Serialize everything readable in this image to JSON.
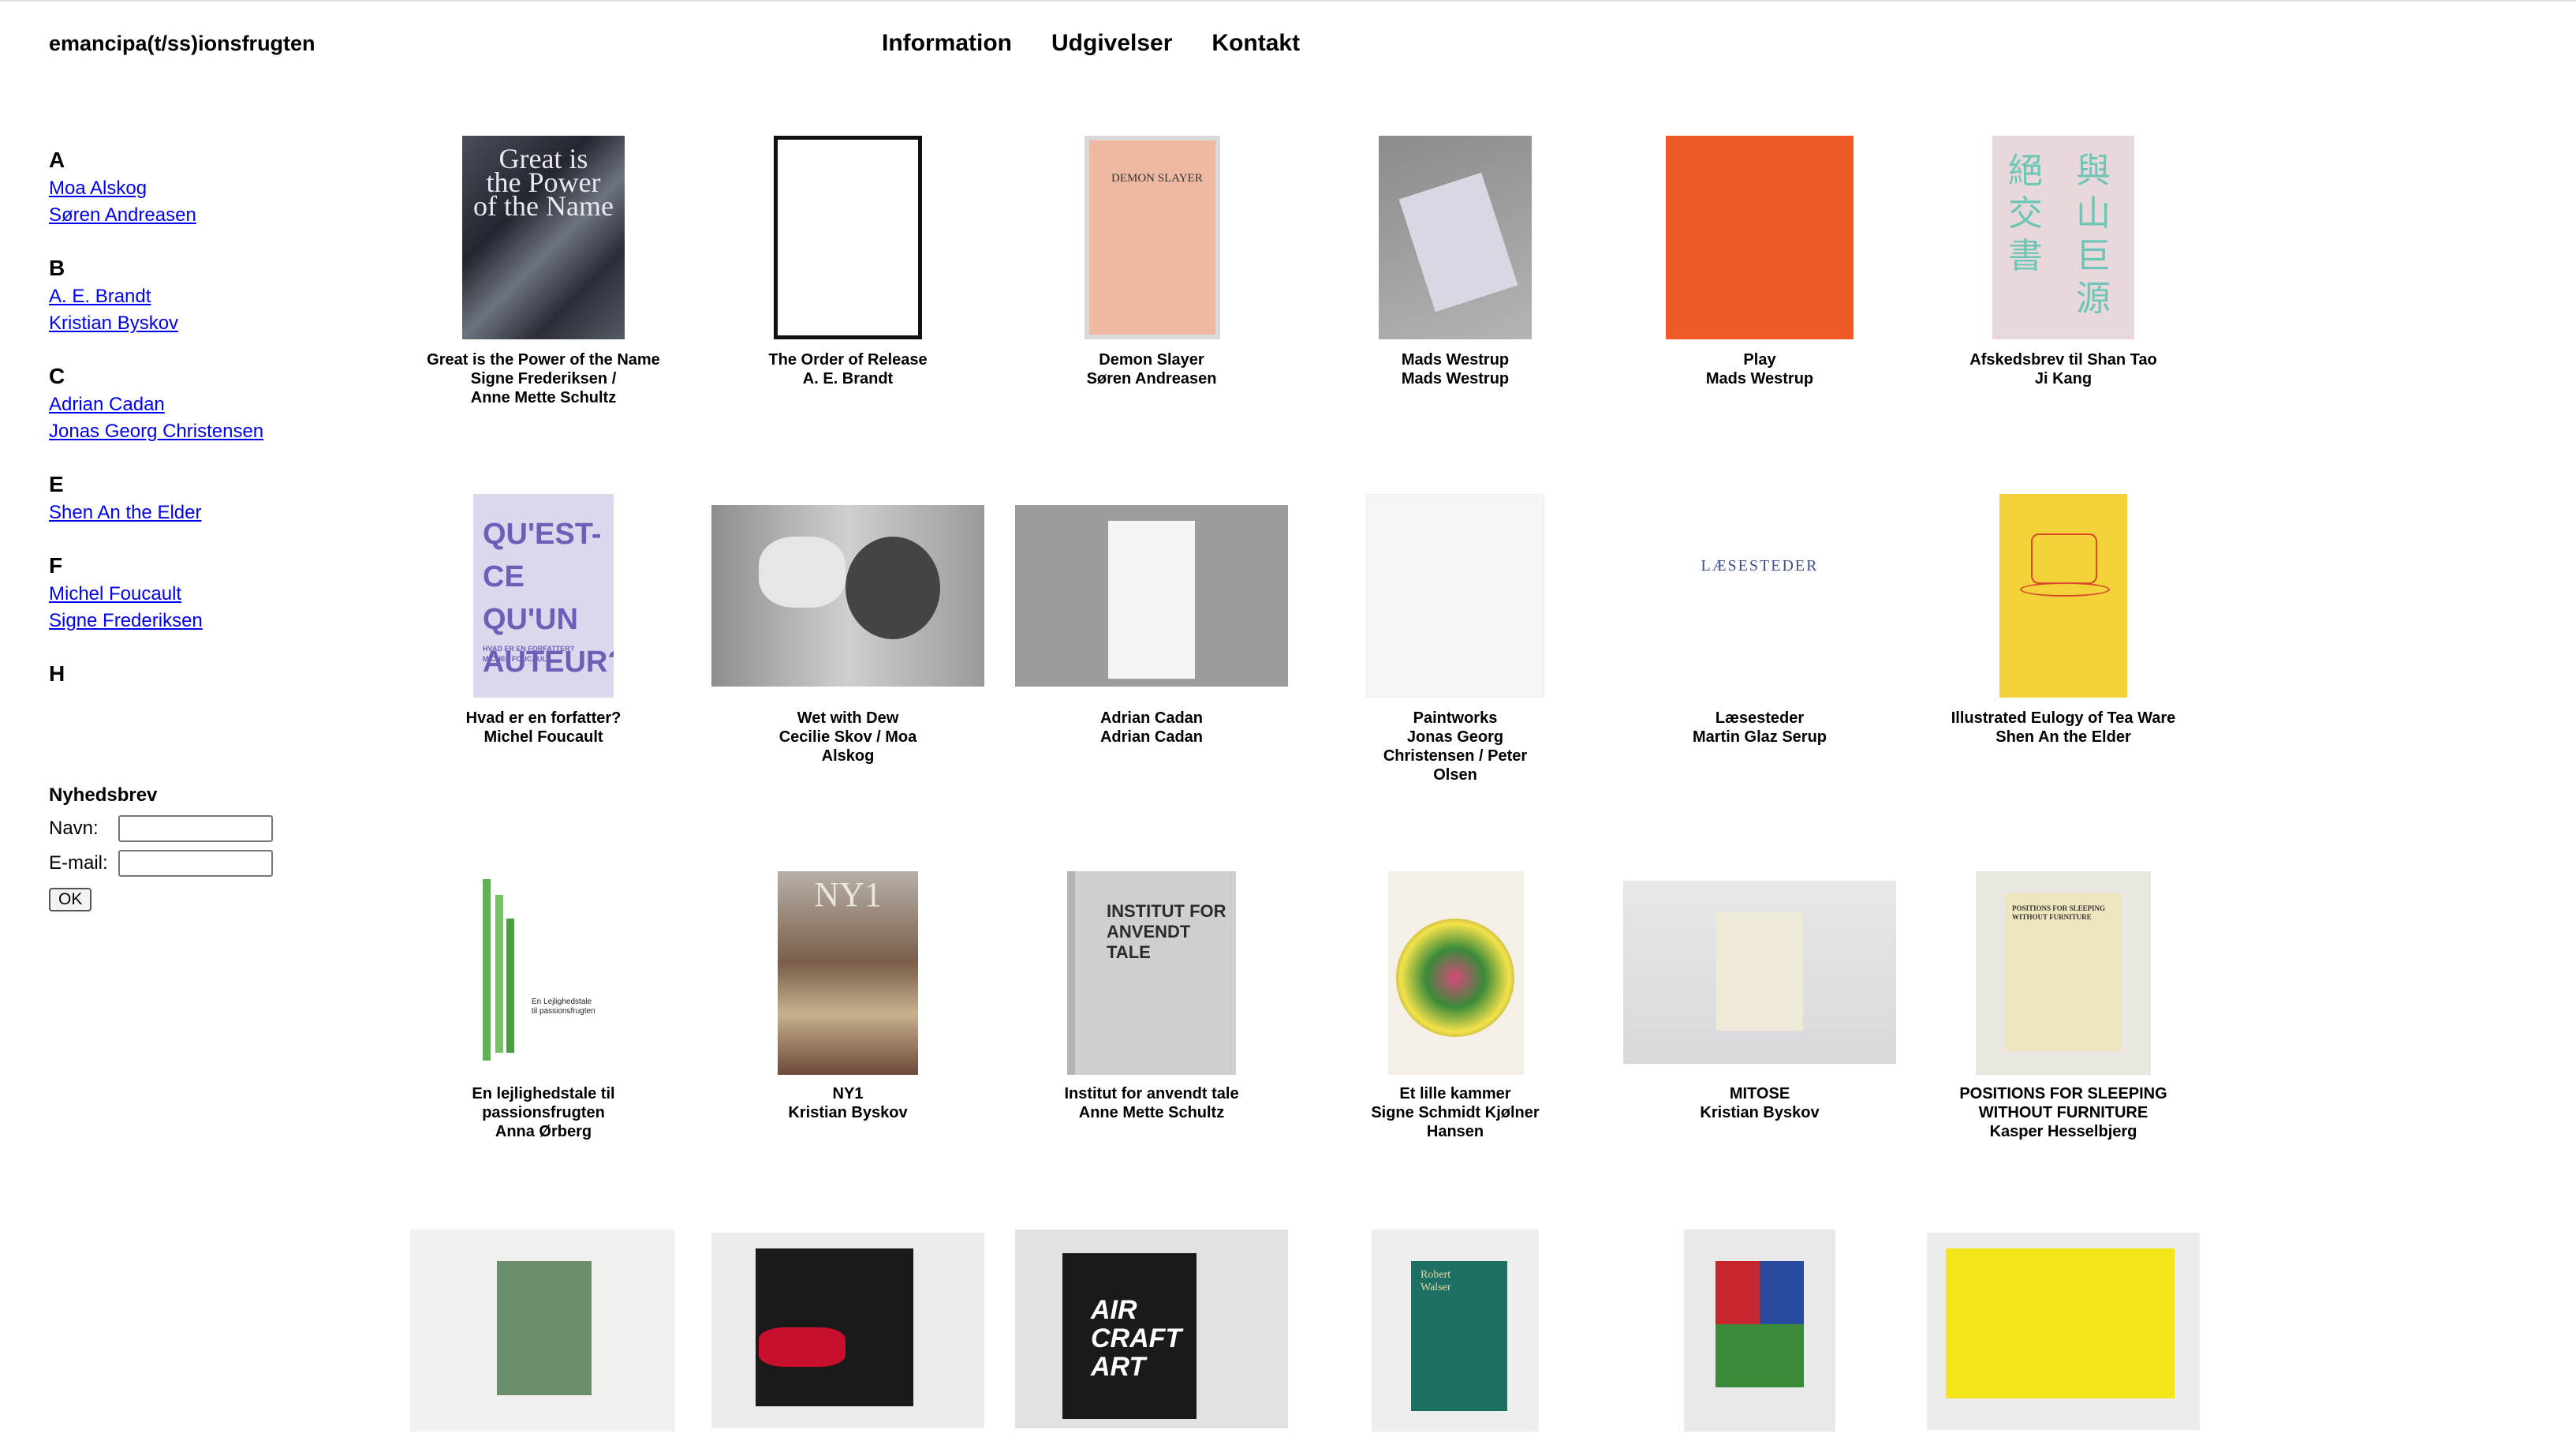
{
  "site": {
    "title": "emancipa(t/ss)ionsfrugten"
  },
  "nav": {
    "items": [
      "Information",
      "Udgivelser",
      "Kontakt"
    ]
  },
  "sidebar": {
    "groups": [
      {
        "letter": "A",
        "authors": [
          "Moa Alskog",
          "Søren Andreasen"
        ]
      },
      {
        "letter": "B",
        "authors": [
          "A. E. Brandt",
          "Kristian Byskov"
        ]
      },
      {
        "letter": "C",
        "authors": [
          "Adrian Cadan",
          "Jonas Georg Christensen"
        ]
      },
      {
        "letter": "E",
        "authors": [
          "Shen An the Elder"
        ]
      },
      {
        "letter": "F",
        "authors": [
          "Michel Foucault",
          "Signe Frederiksen"
        ]
      },
      {
        "letter": "H",
        "authors": []
      }
    ]
  },
  "newsletter": {
    "title": "Nyhedsbrev",
    "name_label": "Navn:",
    "email_label": "E-mail:",
    "name_value": "",
    "email_value": "",
    "submit_label": "OK"
  },
  "covers": {
    "great_power": "Great is\nthe Power\nof the Name",
    "demon_slayer": "DEMON SLAYER",
    "cjk_left": "絕\n交\n書",
    "cjk_right": "與\n山\n巨\n源",
    "quest": "QU'EST-\nCE QU'UN\nAUTEUR?",
    "quest_sub": "HVAD ER EN FORFATTER?\nMICHEL FOUCAULT",
    "laesesteder": "LÆSESTEDER",
    "lejlighed": "En Lejlighedstale\ntil passionsfrugten",
    "ny1": "NY1",
    "institut": "INSTITUT FOR\nANVENDT TALE",
    "positions": "POSITIONS FOR SLEEPING\nWITHOUT FURNITURE",
    "aircraft": "AIR\nCRAFT\nART",
    "walser": "Robert\nWalser"
  },
  "books": [
    {
      "title": "Great is the Power of the Name",
      "author": "Signe Frederiksen /\nAnne Mette Schultz"
    },
    {
      "title": "The Order of Release",
      "author": "A. E. Brandt"
    },
    {
      "title": "Demon Slayer",
      "author": "Søren Andreasen"
    },
    {
      "title": "Mads Westrup",
      "author": "Mads Westrup"
    },
    {
      "title": "Play",
      "author": "Mads Westrup"
    },
    {
      "title": "Afskedsbrev til Shan Tao",
      "author": "Ji Kang"
    },
    {
      "title": "Hvad er en forfatter?",
      "author": "Michel Foucault"
    },
    {
      "title": "Wet with Dew",
      "author": "Cecilie Skov / Moa\nAlskog"
    },
    {
      "title": "Adrian Cadan",
      "author": "Adrian Cadan"
    },
    {
      "title": "Paintworks",
      "author": "Jonas Georg\nChristensen / Peter\nOlsen"
    },
    {
      "title": "Læsesteder",
      "author": "Martin Glaz Serup"
    },
    {
      "title": "Illustrated Eulogy of Tea Ware",
      "author": "Shen An the Elder"
    },
    {
      "title": "En lejlighedstale til passionsfrugten",
      "author": "Anna Ørberg"
    },
    {
      "title": "NY1",
      "author": "Kristian Byskov"
    },
    {
      "title": "Institut for anvendt tale",
      "author": "Anne Mette Schultz"
    },
    {
      "title": "Et lille kammer",
      "author": "Signe Schmidt Kjølner\nHansen"
    },
    {
      "title": "MITOSE",
      "author": "Kristian Byskov"
    },
    {
      "title": "POSITIONS FOR SLEEPING\nWITHOUT FURNITURE",
      "author": "Kasper Hesselbjerg"
    }
  ]
}
